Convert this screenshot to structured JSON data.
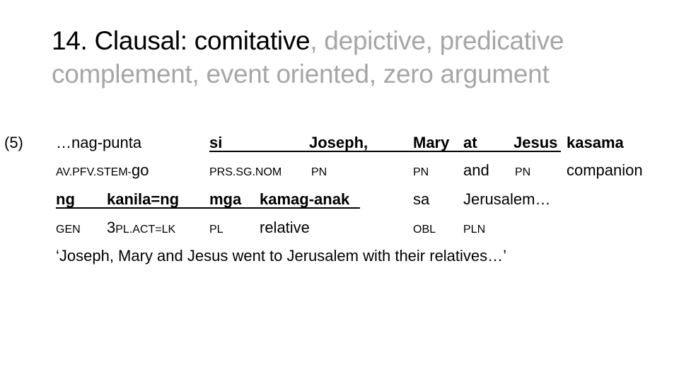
{
  "slide": {
    "title_highlight": "14. Clausal: comitative",
    "title_rest": ", depictive, predicative complement, event oriented, zero argument",
    "colors": {
      "highlight": "#000000",
      "dimmed": "#a6a6a6"
    }
  },
  "example": {
    "number": "(5)",
    "line1": {
      "words": [
        {
          "text": "…nag-punta",
          "bold": false,
          "underlined": false
        },
        {
          "text": "si",
          "bold": true,
          "underlined": true
        },
        {
          "text": "Joseph,",
          "bold": true,
          "underlined": true
        },
        {
          "text": "Mary",
          "bold": true,
          "underlined": true
        },
        {
          "text": "at",
          "bold": true,
          "underlined": true
        },
        {
          "text": "Jesus",
          "bold": true,
          "underlined": true
        },
        {
          "text": "kasama",
          "bold": true,
          "underlined": false
        }
      ],
      "glosses": [
        {
          "smallcaps": "AV.PFV.STEM-",
          "normal": "go"
        },
        {
          "smallcaps": "PRS.SG.NOM",
          "normal": ""
        },
        {
          "smallcaps": "PN",
          "normal": ""
        },
        {
          "smallcaps": "PN",
          "normal": ""
        },
        {
          "smallcaps": "",
          "normal": "and"
        },
        {
          "smallcaps": "PN",
          "normal": ""
        },
        {
          "smallcaps": "",
          "normal": "companion"
        }
      ]
    },
    "line2": {
      "words": [
        {
          "text": "ng",
          "bold": true,
          "underlined": true
        },
        {
          "text": "kanila=ng",
          "bold": true,
          "underlined": true
        },
        {
          "text": "mga",
          "bold": true,
          "underlined": true
        },
        {
          "text": "kamag-anak",
          "bold": true,
          "underlined": true
        },
        {
          "text": "sa",
          "bold": false,
          "underlined": false
        },
        {
          "text": "Jerusalem…",
          "bold": false,
          "underlined": false
        }
      ],
      "glosses": [
        {
          "prefix": "",
          "smallcaps": "GEN",
          "normal": ""
        },
        {
          "prefix": "3",
          "smallcaps": "PL.ACT=LK",
          "normal": ""
        },
        {
          "prefix": "",
          "smallcaps": "PL",
          "normal": ""
        },
        {
          "prefix": "",
          "smallcaps": "",
          "normal": "relative"
        },
        {
          "prefix": "",
          "smallcaps": "OBL",
          "normal": ""
        },
        {
          "prefix": "",
          "smallcaps": "PLN",
          "normal": ""
        }
      ]
    },
    "translation": "‘Joseph, Mary and Jesus went to Jerusalem with their relatives…’"
  }
}
